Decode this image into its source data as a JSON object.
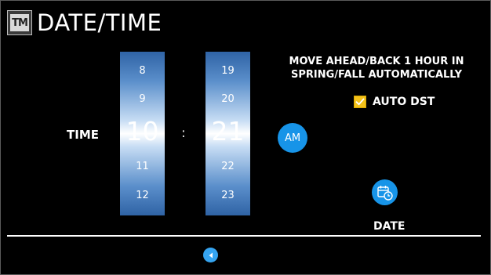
{
  "header": {
    "logo_text": "TM",
    "title": "DATE/TIME"
  },
  "time": {
    "label": "TIME",
    "separator": ":",
    "hours": [
      "8",
      "9",
      "10",
      "11",
      "12"
    ],
    "minutes": [
      "19",
      "20",
      "21",
      "22",
      "23"
    ],
    "period": "AM"
  },
  "dst": {
    "description": "MOVE AHEAD/BACK 1 HOUR IN SPRING/FALL AUTOMATICALLY",
    "label": "AUTO DST",
    "checked": true
  },
  "date_button": {
    "label": "DATE",
    "icon": "calendar-clock-icon"
  },
  "nav": {
    "back_icon": "back-arrow-icon"
  },
  "colors": {
    "accent": "#1794e8",
    "wheel_dark": "#2f63a5",
    "checkbox": "#f4c21a",
    "background": "#000000"
  }
}
